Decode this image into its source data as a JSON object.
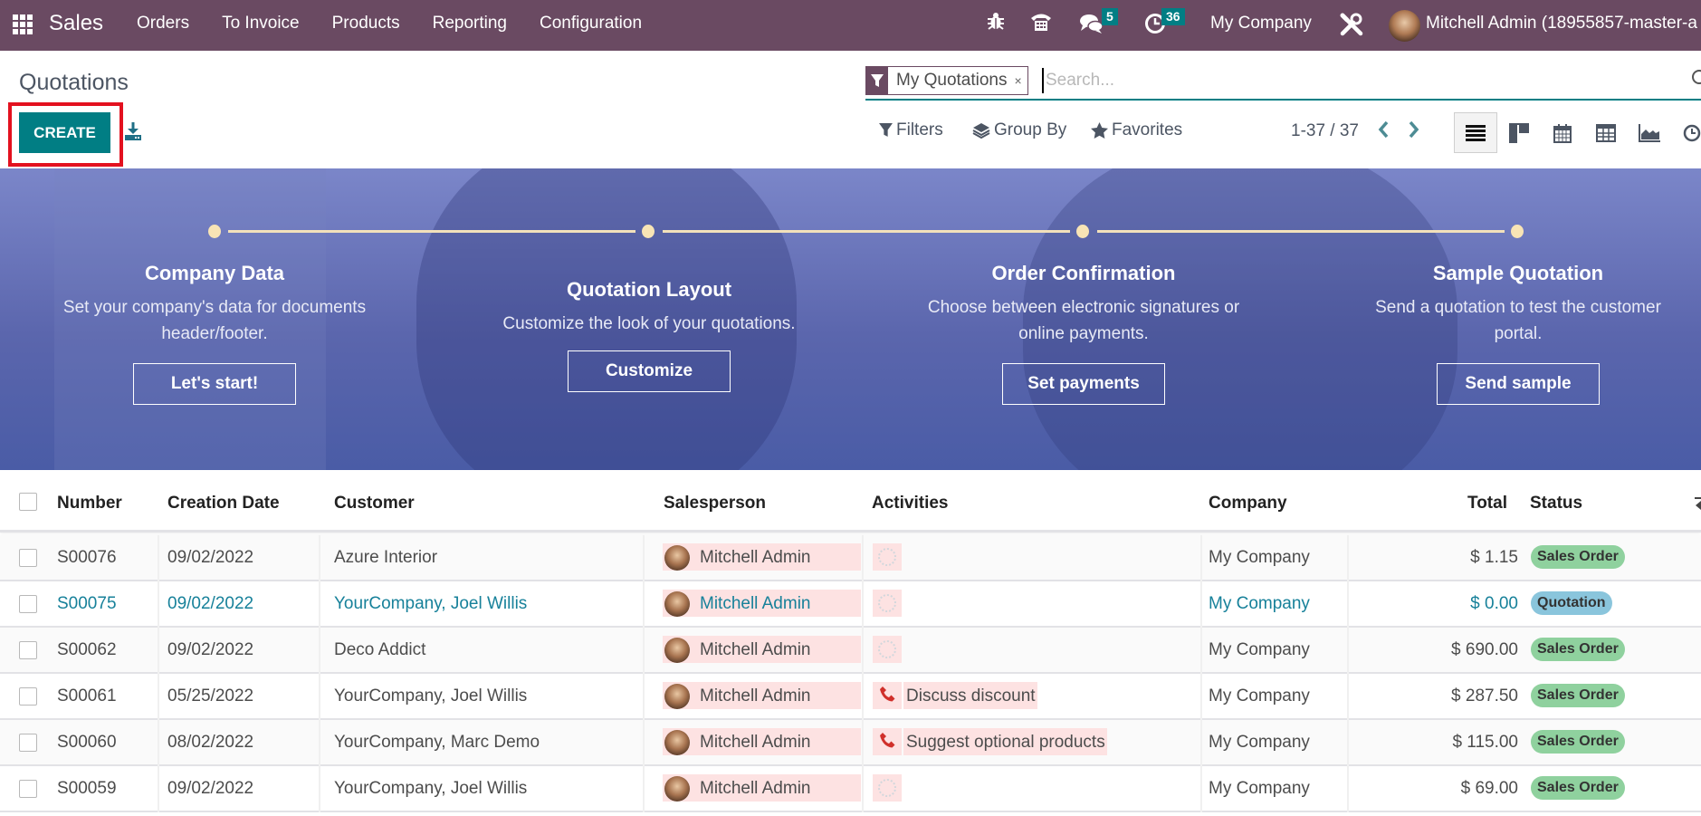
{
  "navbar": {
    "app_name": "Sales",
    "menu": [
      "Orders",
      "To Invoice",
      "Products",
      "Reporting",
      "Configuration"
    ],
    "icons": [
      "apps-grid-icon",
      "bug-icon",
      "phone-icon",
      "chat-icon",
      "activity-clock-icon",
      "tools-icon"
    ],
    "messages_count": "5",
    "activities_count": "36",
    "company": "My Company",
    "user": "Mitchell Admin (18955857-master-a"
  },
  "control_panel": {
    "title": "Quotations",
    "create_label": "CREATE",
    "search": {
      "facet_label": "My Quotations",
      "facet_remove": "×",
      "placeholder": "Search...",
      "value": ""
    },
    "filters_label": "Filters",
    "group_by_label": "Group By",
    "favorites_label": "Favorites",
    "pager": "1-37 / 37",
    "views": [
      "list",
      "kanban",
      "calendar",
      "pivot",
      "graph",
      "activity"
    ],
    "active_view": "list"
  },
  "onboarding": {
    "steps": [
      {
        "title": "Company Data",
        "desc_lines": [
          "Set your company's data for documents",
          "header/footer."
        ],
        "button": "Let's start!"
      },
      {
        "title": "Quotation Layout",
        "desc_lines": [
          "Customize the look of your quotations."
        ],
        "button": "Customize"
      },
      {
        "title": "Order Confirmation",
        "desc_lines": [
          "Choose between electronic signatures or",
          "online payments."
        ],
        "button": "Set payments"
      },
      {
        "title": "Sample Quotation",
        "desc_lines": [
          "Send a quotation to test the customer",
          "portal."
        ],
        "button": "Send sample"
      }
    ]
  },
  "table": {
    "columns": [
      "Number",
      "Creation Date",
      "Customer",
      "Salesperson",
      "Activities",
      "Company",
      "Total",
      "Status"
    ],
    "rows": [
      {
        "number": "S00076",
        "date": "09/02/2022",
        "customer": "Azure Interior",
        "salesperson": "Mitchell Admin",
        "activity": "",
        "company": "My Company",
        "total": "$ 1.15",
        "status": "Sales Order",
        "highlight": false
      },
      {
        "number": "S00075",
        "date": "09/02/2022",
        "customer": "YourCompany, Joel Willis",
        "salesperson": "Mitchell Admin",
        "activity": "",
        "company": "My Company",
        "total": "$ 0.00",
        "status": "Quotation",
        "highlight": true
      },
      {
        "number": "S00062",
        "date": "09/02/2022",
        "customer": "Deco Addict",
        "salesperson": "Mitchell Admin",
        "activity": "",
        "company": "My Company",
        "total": "$ 690.00",
        "status": "Sales Order",
        "highlight": false
      },
      {
        "number": "S00061",
        "date": "05/25/2022",
        "customer": "YourCompany, Joel Willis",
        "salesperson": "Mitchell Admin",
        "activity": "Discuss discount",
        "company": "My Company",
        "total": "$ 287.50",
        "status": "Sales Order",
        "highlight": false
      },
      {
        "number": "S00060",
        "date": "08/02/2022",
        "customer": "YourCompany, Marc Demo",
        "salesperson": "Mitchell Admin",
        "activity": "Suggest optional products",
        "company": "My Company",
        "total": "$ 115.00",
        "status": "Sales Order",
        "highlight": false
      },
      {
        "number": "S00059",
        "date": "09/02/2022",
        "customer": "YourCompany, Joel Willis",
        "salesperson": "Mitchell Admin",
        "activity": "",
        "company": "My Company",
        "total": "$ 69.00",
        "status": "Sales Order",
        "highlight": false
      }
    ]
  },
  "colors": {
    "brand": "#6a4a62",
    "primary": "#017e84",
    "link": "#17819a",
    "sales_order_badge": "#8fd19e",
    "quotation_badge": "#8ac5dc",
    "highlight_box": "#e3111f",
    "overdue_bg": "#fde2e2"
  }
}
